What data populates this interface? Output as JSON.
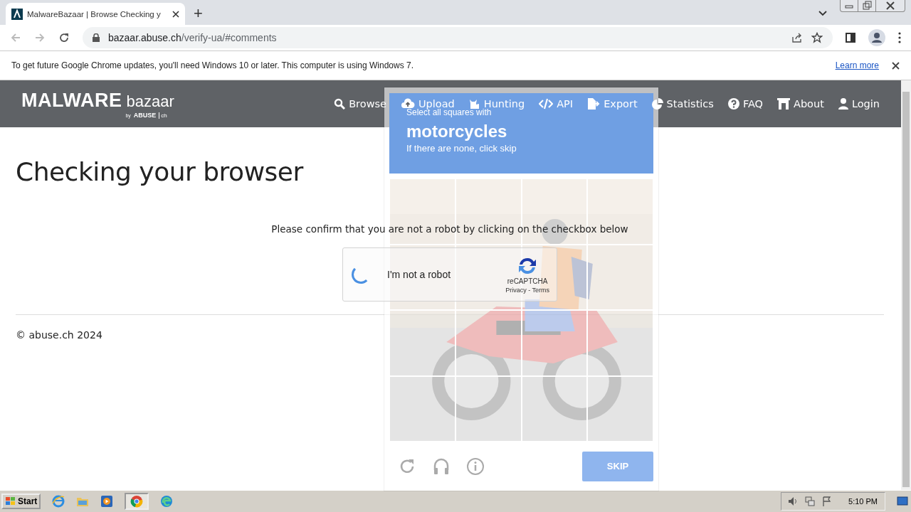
{
  "browser": {
    "tab": {
      "title": "MalwareBazaar | Browse Checking y",
      "selected": true
    },
    "new_tab": "+",
    "url_host": "bazaar.abuse.ch",
    "url_path": "/verify-ua/#comments"
  },
  "infobar": {
    "message": "To get future Google Chrome updates, you'll need Windows 10 or later. This computer is using Windows 7.",
    "link": "Learn more"
  },
  "site": {
    "logo_main": "MALWARE",
    "logo_sub": "bazaar",
    "logo_by": "by",
    "logo_org": "ABUSE",
    "logo_ch": "ch",
    "nav": [
      "Browse",
      "Upload",
      "Hunting",
      "API",
      "Export",
      "Statistics",
      "FAQ",
      "About",
      "Login"
    ]
  },
  "page": {
    "heading": "Checking your browser",
    "prompt": "Please confirm that you are not a robot by clicking on the checkbox below",
    "recaptcha": {
      "label": "I'm not a robot",
      "brand": "reCAPTCHA",
      "links": "Privacy - Terms",
      "loading": true
    },
    "footer": "© abuse.ch 2024"
  },
  "challenge": {
    "instruction": "Select all squares with",
    "object": "motorcycles",
    "hint": "If there are none, click skip",
    "skip": "SKIP"
  },
  "taskbar": {
    "start": "Start",
    "clock": "5:10 PM"
  }
}
